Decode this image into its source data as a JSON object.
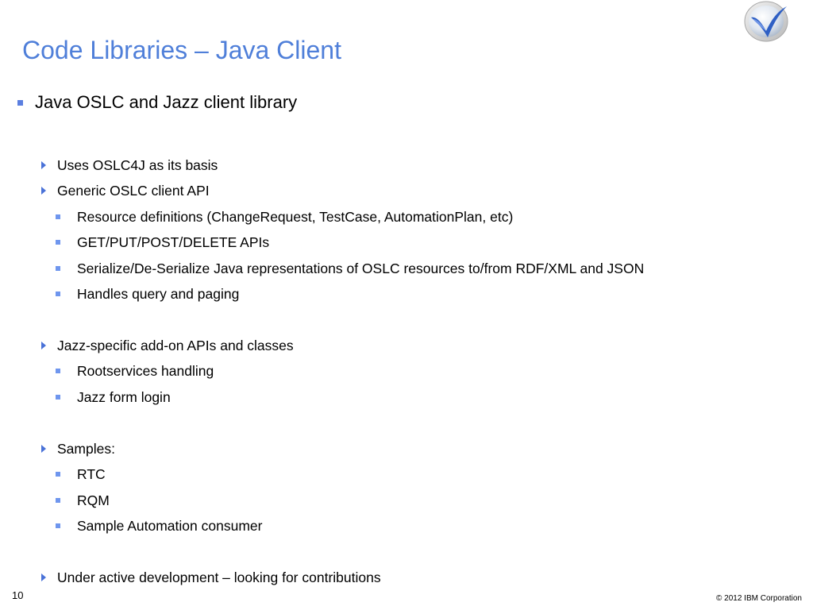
{
  "slide": {
    "title": "Code Libraries – Java Client",
    "page_number": "10",
    "copyright": "© 2012 IBM Corporation",
    "colors": {
      "title": "#4f7fd9",
      "bullet": "#5b7fe0",
      "arrow": "#4a72d8"
    }
  },
  "content": {
    "main_bullet": "Java OSLC and Jazz client library",
    "uses_oslc4j": "Uses OSLC4J as its basis",
    "generic_api": "Generic OSLC client API",
    "resource_definitions": "Resource definitions (ChangeRequest, TestCase, AutomationPlan, etc)",
    "http_apis": "GET/PUT/POST/DELETE APIs",
    "serialize": "Serialize/De-Serialize Java representations of OSLC resources to/from RDF/XML and JSON",
    "query_paging": "Handles query and paging",
    "jazz_specific": "Jazz-specific add-on APIs and classes",
    "rootservices": "Rootservices handling",
    "form_login": "Jazz form login",
    "samples": "Samples:",
    "rtc": "RTC",
    "rqm": "RQM",
    "automation_consumer": "Sample Automation consumer",
    "active_development": "Under active development – looking for contributions"
  },
  "icons": {
    "logo": "globe-swoosh-logo-icon",
    "level1_bullet": "square-bullet-icon",
    "level2_bullet": "triangle-arrow-icon",
    "level3_bullet": "small-square-bullet-icon"
  }
}
